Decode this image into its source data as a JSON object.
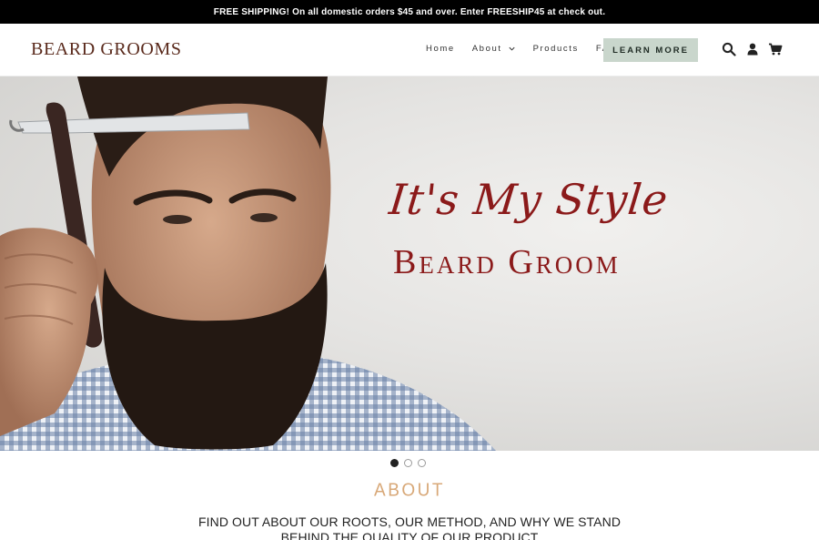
{
  "announcement": {
    "text": "FREE SHIPPING! On all domestic orders $45 and over. Enter FREESHIP45 at check out."
  },
  "header": {
    "logo": "BEARD GROOMS",
    "nav": [
      {
        "label": "Home"
      },
      {
        "label": "About"
      },
      {
        "label": "Products"
      },
      {
        "label": "FAQ"
      }
    ],
    "cta_label": "LEARN MORE",
    "icons": [
      "search-icon",
      "account-icon",
      "cart-icon"
    ]
  },
  "hero": {
    "script_line": "It's My Style",
    "headline": "Beard Groom",
    "slides_total": 3,
    "active_slide": 1
  },
  "about": {
    "title": "ABOUT",
    "text": "FIND OUT ABOUT OUR ROOTS, OUR METHOD, AND WHY WE STAND BEHIND THE QUALITY OF OUR PRODUCT"
  },
  "colors": {
    "announce_bg": "#000000",
    "logo": "#5a2a1c",
    "cta_bg": "#c9d6cc",
    "hero_text": "#8b1a1a",
    "about_title": "#d8a878"
  }
}
